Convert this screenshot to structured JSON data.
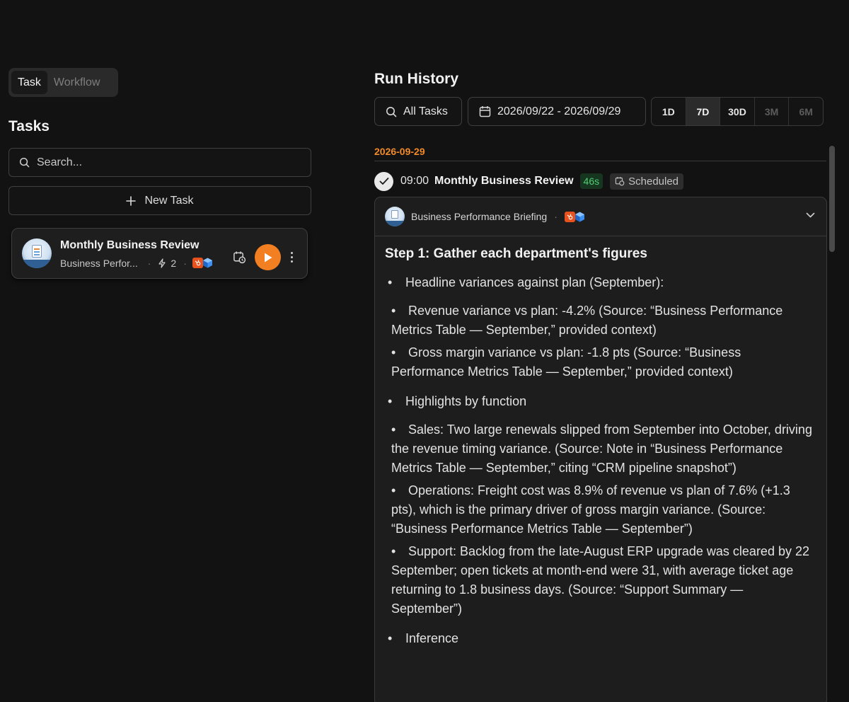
{
  "mode_toggle": {
    "task": "Task",
    "workflow": "Workflow"
  },
  "tasks_panel": {
    "title": "Tasks",
    "search_placeholder": "Search...",
    "new_task_label": "New Task",
    "card": {
      "title": "Monthly Business Review",
      "subtitle": "Business Perfor...",
      "trigger_count": "2"
    }
  },
  "run_history": {
    "title": "Run History",
    "filter_all_tasks": "All Tasks",
    "date_range": "2026/09/22 - 2026/09/29",
    "ranges": [
      "1D",
      "7D",
      "30D",
      "3M",
      "6M"
    ],
    "selected_range": "7D",
    "date_group": "2026-09-29",
    "run": {
      "time": "09:00",
      "name": "Monthly Business Review",
      "duration": "46s",
      "trigger_label": "Scheduled"
    },
    "briefing": {
      "agent_name": "Business Performance Briefing",
      "step_title": "Step 1: Gather each department's figures",
      "sections": [
        {
          "heading": "Headline variances against plan (September):",
          "items": [
            "Revenue variance vs plan: -4.2% (Source: “Business Performance Metrics Table — September,” provided context)",
            "Gross margin variance vs plan: -1.8 pts (Source: “Business Performance Metrics Table — September,” provided context)"
          ]
        },
        {
          "heading": "Highlights by function",
          "items": [
            "Sales: Two large renewals slipped from September into October, driving the revenue timing variance. (Source: Note in “Business Performance Metrics Table — September,” citing “CRM pipeline snapshot”)",
            "Operations: Freight cost was 8.9% of revenue vs plan of 7.6% (+1.3 pts), which is the primary driver of gross margin variance. (Source: “Business Performance Metrics Table — September”)",
            "Support: Backlog from the late-August ERP upgrade was cleared by 22 September; open tickets at month-end were 31, with average ticket age returning to 1.8 business days. (Source: “Support Summary — September”)"
          ]
        },
        {
          "heading": "Inference",
          "items": []
        }
      ]
    }
  },
  "colors": {
    "accent": "#f27f21",
    "background": "#121212",
    "success": "#4fd074"
  }
}
